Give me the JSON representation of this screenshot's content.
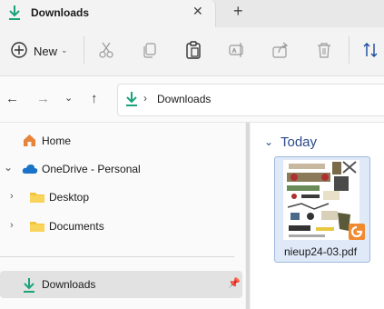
{
  "tab": {
    "title": "Downloads",
    "close_icon": "close-icon",
    "add_icon": "plus-icon"
  },
  "toolbar": {
    "new_label": "New",
    "icons": [
      "new-icon",
      "cut-icon",
      "copy-icon",
      "paste-icon",
      "rename-icon",
      "share-icon",
      "delete-icon",
      "sort-icon"
    ]
  },
  "address": {
    "path": "Downloads"
  },
  "sidebar": {
    "items": [
      {
        "label": "Home",
        "icon": "home-icon"
      },
      {
        "label": "OneDrive - Personal",
        "icon": "cloud-icon"
      },
      {
        "label": "Desktop",
        "icon": "folder-icon"
      },
      {
        "label": "Documents",
        "icon": "folder-icon"
      },
      {
        "label": "Downloads",
        "icon": "download-icon"
      }
    ]
  },
  "content": {
    "group_title": "Today",
    "file_name": "nieup24-03.pdf",
    "file_type": "pdf"
  },
  "colors": {
    "accent": "#1a73c9",
    "download_green": "#1aa37a",
    "folder": "#f3c53f",
    "selected_bg": "#e2e2e2"
  }
}
